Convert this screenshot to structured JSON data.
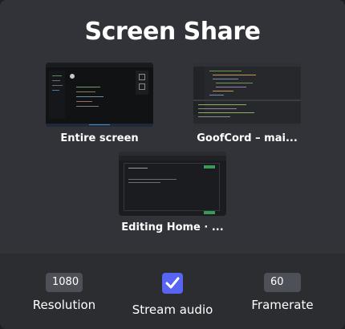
{
  "dialog": {
    "title": "Screen Share"
  },
  "sources": [
    {
      "label": "Entire screen"
    },
    {
      "label": "GoofCord – mai..."
    },
    {
      "label": "Editing Home · ..."
    }
  ],
  "controls": {
    "resolution": {
      "value": "1080",
      "label": "Resolution"
    },
    "audio": {
      "label": "Stream audio",
      "checked": true
    },
    "framerate": {
      "value": "60",
      "label": "Framerate"
    }
  },
  "colors": {
    "dialog_bg": "#313338",
    "footer_bg": "#2b2d31",
    "accent": "#5865f2",
    "input_bg": "#4e5058"
  }
}
